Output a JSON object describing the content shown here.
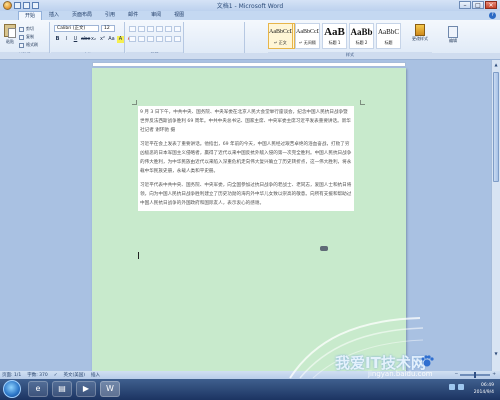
{
  "window": {
    "title": "文档1 - Microsoft Word",
    "controls": [
      "–",
      "□",
      "✕"
    ]
  },
  "tabs": [
    "开始",
    "插入",
    "页面布局",
    "引用",
    "邮件",
    "审阅",
    "视图"
  ],
  "ribbon": {
    "clipboard": {
      "paste_label": "粘贴",
      "cut_label": "剪切",
      "copy_label": "复制",
      "painter_label": "格式刷",
      "group_label": "剪贴板"
    },
    "font": {
      "name_value": "Calibri (正文)",
      "size_value": "12",
      "group_label": "字体",
      "format_buttons": [
        "B",
        "I",
        "U",
        "abe",
        "x₂",
        "x²",
        "Aa",
        "A",
        "A"
      ]
    },
    "paragraph": {
      "group_label": "段落"
    },
    "styles": {
      "tiles": [
        {
          "sample": "AaBbCcD",
          "name": "↵ 正文"
        },
        {
          "sample": "AaBbCcD",
          "name": "↵ 无间隔"
        },
        {
          "sample": "AaB",
          "name": "标题 1"
        },
        {
          "sample": "AaBb",
          "name": "标题 2"
        },
        {
          "sample": "AaBbC",
          "name": "标题"
        }
      ],
      "change_label": "更改样式",
      "group_label": "样式"
    },
    "editing": {
      "label": "编辑"
    }
  },
  "document": {
    "paragraphs": [
      "9 月 3 日下午，中共中央、国务院、中央军委在北京人民大会堂举行座谈会，纪念中国人民抗日战争暨世界反法西斯战争胜利 69 周年。中共中央总书记、国家主席、中央军委主席习近平发表重要讲话。新华社记者 谢环驰 摄",
      "习近平在会上发表了重要讲话。他指出，69 年前的今天，中国人民经过艰苦卓绝的浴血奋战，打败了穷凶极恶的日本军国主义侵略者，赢得了近代以来中国反抗外敌入侵的第一次完全胜利。中国人民抗日战争的伟大胜利，为中华民族由近代以来陷入深重危机走向伟大复兴确立了历史转折点，这一伟大胜利，将永载中华民族史册，永载人类和平史册。",
      "习近平代表中共中央、国务院、中央军委，向全国参加过抗日战争的老战士、老同志，爱国人士和抗日将领，向为中国人民抗日战争胜利建立了历史功勋的海内外中华儿女致以崇高的敬意。向所有支援和帮助过中国人民抗日战争的外国政府和国际友人，表示衷心的感谢。"
    ]
  },
  "status": {
    "page": "页面: 1/1",
    "words": "字数: 370",
    "lang": "英文(美国)",
    "mode": "插入"
  },
  "taskbar": {
    "time": "06:49",
    "date": "2014/9/4"
  },
  "watermark": {
    "text": "我爱IT技术网",
    "url": "jingyan.baidu.com"
  }
}
